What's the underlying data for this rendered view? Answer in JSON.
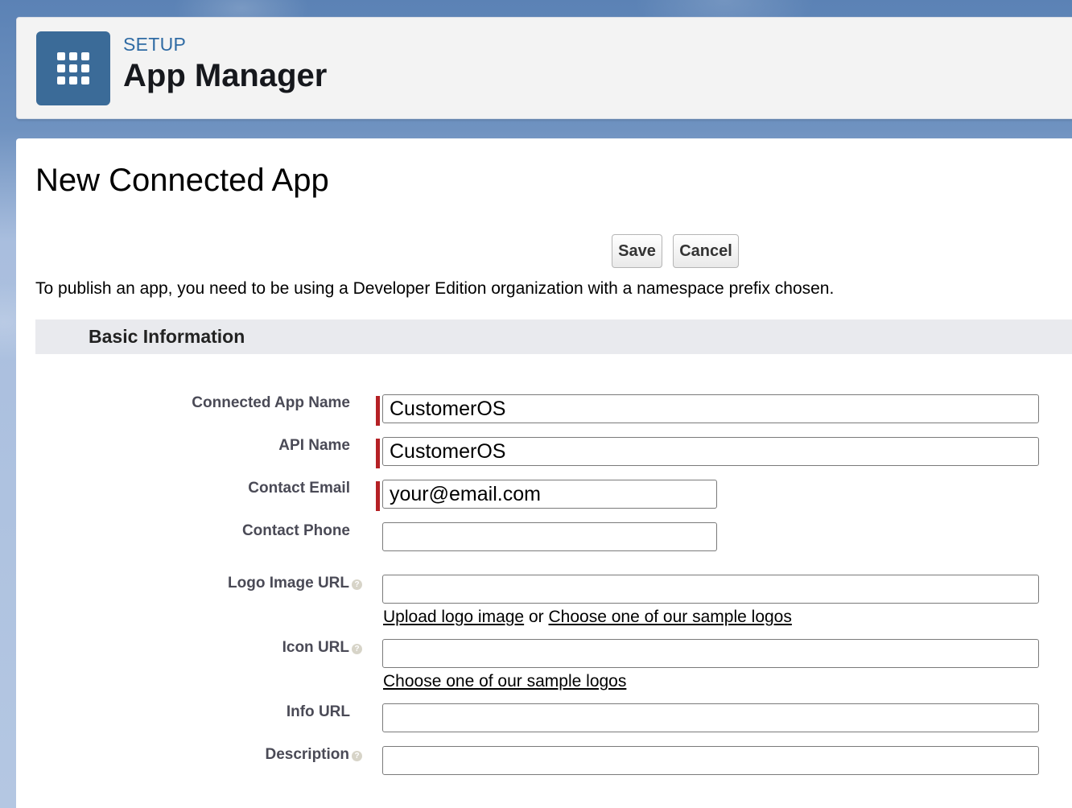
{
  "header": {
    "eyebrow": "SETUP",
    "title": "App Manager",
    "app_icon": "app-launcher-grid-icon"
  },
  "form": {
    "title": "New Connected App",
    "save_label": "Save",
    "cancel_label": "Cancel",
    "notice": "To publish an app, you need to be using a Developer Edition organization with a namespace prefix chosen.",
    "section_title": "Basic Information",
    "fields": {
      "connected_app_name": {
        "label": "Connected App Name",
        "value": "CustomerOS",
        "required": true
      },
      "api_name": {
        "label": "API Name",
        "value": "CustomerOS",
        "required": true
      },
      "contact_email": {
        "label": "Contact Email",
        "value": "your@email.com",
        "required": true
      },
      "contact_phone": {
        "label": "Contact Phone",
        "value": "",
        "required": false
      },
      "logo_image_url": {
        "label": "Logo Image URL",
        "value": "",
        "help": true
      },
      "icon_url": {
        "label": "Icon URL",
        "value": "",
        "help": true
      },
      "info_url": {
        "label": "Info URL",
        "value": ""
      },
      "description": {
        "label": "Description",
        "value": "",
        "help": true
      }
    },
    "logo_links": {
      "upload": "Upload logo image",
      "or": "or",
      "choose": "Choose one of our sample logos"
    },
    "icon_links": {
      "choose": "Choose one of our sample logos"
    }
  },
  "colors": {
    "required_marker": "#b52125",
    "app_icon_bg": "#3b6b98",
    "setup_label": "#2f6ba4",
    "section_bar": "#e9eaee"
  }
}
